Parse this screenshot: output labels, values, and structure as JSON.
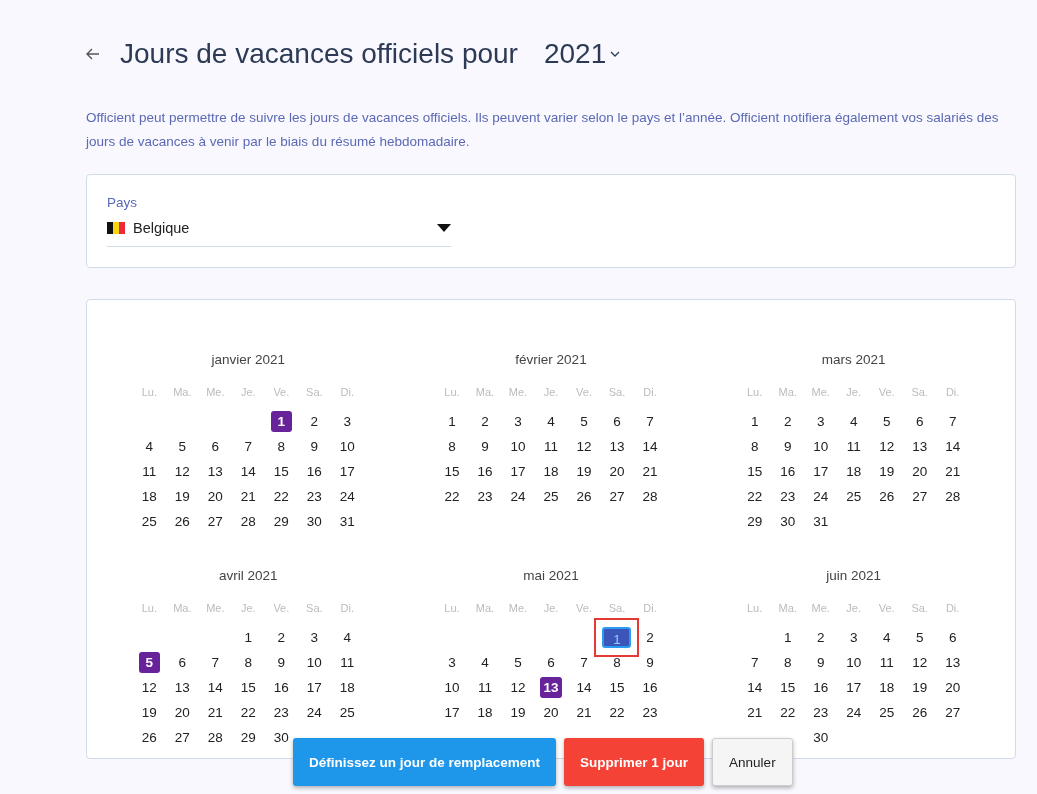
{
  "header": {
    "title": "Jours de vacances officiels pour",
    "year": "2021"
  },
  "description": "Officient peut permettre de suivre les jours de vacances officiels. Ils peuvent varier selon le pays et l’année. Officient notifiera également vos salariés des jours de vacances à venir par le biais du résumé hebdomadaire.",
  "country": {
    "label": "Pays",
    "value": "Belgique"
  },
  "months": [
    {
      "name": "janvier 2021",
      "weekdays": [
        "Lu.",
        "Ma.",
        "Me.",
        "Je.",
        "Ve.",
        "Sa.",
        "Di."
      ],
      "weeks": [
        {
          "kind": "lead",
          "days": [
            {
              "day": "1",
              "kind": "holiday"
            },
            "2",
            "3"
          ]
        },
        {
          "kind": "full",
          "days": [
            "4",
            "5",
            "6",
            "7",
            "8",
            "9",
            "10"
          ]
        },
        {
          "kind": "full",
          "days": [
            "11",
            "12",
            "13",
            "14",
            "15",
            "16",
            "17"
          ]
        },
        {
          "kind": "full",
          "days": [
            "18",
            "19",
            "20",
            "21",
            "22",
            "23",
            "24"
          ]
        },
        {
          "kind": "full",
          "days": [
            "25",
            "26",
            "27",
            "28",
            "29",
            "30",
            "31"
          ]
        }
      ]
    },
    {
      "name": "février 2021",
      "weekdays": [
        "Lu.",
        "Ma.",
        "Me.",
        "Je.",
        "Ve.",
        "Sa.",
        "Di."
      ],
      "weeks": [
        {
          "kind": "full",
          "days": [
            "1",
            "2",
            "3",
            "4",
            "5",
            "6",
            "7"
          ]
        },
        {
          "kind": "full",
          "days": [
            "8",
            "9",
            "10",
            "11",
            "12",
            "13",
            "14"
          ]
        },
        {
          "kind": "full",
          "days": [
            "15",
            "16",
            "17",
            "18",
            "19",
            "20",
            "21"
          ]
        },
        {
          "kind": "full",
          "days": [
            "22",
            "23",
            "24",
            "25",
            "26",
            "27",
            "28"
          ]
        }
      ]
    },
    {
      "name": "mars 2021",
      "weekdays": [
        "Lu.",
        "Ma.",
        "Me.",
        "Je.",
        "Ve.",
        "Sa.",
        "Di."
      ],
      "weeks": [
        {
          "kind": "full",
          "days": [
            "1",
            "2",
            "3",
            "4",
            "5",
            "6",
            "7"
          ]
        },
        {
          "kind": "full",
          "days": [
            "8",
            "9",
            "10",
            "11",
            "12",
            "13",
            "14"
          ]
        },
        {
          "kind": "full",
          "days": [
            "15",
            "16",
            "17",
            "18",
            "19",
            "20",
            "21"
          ]
        },
        {
          "kind": "full",
          "days": [
            "22",
            "23",
            "24",
            "25",
            "26",
            "27",
            "28"
          ]
        },
        {
          "kind": "trail",
          "days": [
            "29",
            "30",
            "31"
          ]
        }
      ]
    },
    {
      "name": "avril 2021",
      "weekdays": [
        "Lu.",
        "Ma.",
        "Me.",
        "Je.",
        "Ve.",
        "Sa.",
        "Di."
      ],
      "weeks": [
        {
          "kind": "lead",
          "days": [
            "1",
            "2",
            "3",
            "4"
          ]
        },
        {
          "kind": "full",
          "days": [
            {
              "day": "5",
              "kind": "holiday"
            },
            "6",
            "7",
            "8",
            "9",
            "10",
            "11"
          ]
        },
        {
          "kind": "full",
          "days": [
            "12",
            "13",
            "14",
            "15",
            "16",
            "17",
            "18"
          ]
        },
        {
          "kind": "full",
          "days": [
            "19",
            "20",
            "21",
            "22",
            "23",
            "24",
            "25"
          ]
        },
        {
          "kind": "trail",
          "days": [
            "26",
            "27",
            "28",
            "29",
            "30"
          ]
        }
      ]
    },
    {
      "name": "mai 2021",
      "weekdays": [
        "Lu.",
        "Ma.",
        "Me.",
        "Je.",
        "Ve.",
        "Sa.",
        "Di."
      ],
      "weeks": [
        {
          "kind": "lead",
          "days": [
            {
              "day": "1",
              "kind": "selected"
            },
            "2"
          ]
        },
        {
          "kind": "full",
          "days": [
            "3",
            "4",
            "5",
            "6",
            "7",
            "8",
            "9"
          ]
        },
        {
          "kind": "full",
          "days": [
            "10",
            "11",
            "12",
            {
              "day": "13",
              "kind": "holiday"
            },
            "14",
            "15",
            "16"
          ]
        },
        {
          "kind": "full",
          "days": [
            "17",
            "18",
            "19",
            "20",
            "21",
            "22",
            "23"
          ]
        }
      ]
    },
    {
      "name": "juin 2021",
      "weekdays": [
        "Lu.",
        "Ma.",
        "Me.",
        "Je.",
        "Ve.",
        "Sa.",
        "Di."
      ],
      "weeks": [
        {
          "kind": "lead",
          "days": [
            "1",
            "2",
            "3",
            "4",
            "5",
            "6"
          ]
        },
        {
          "kind": "full",
          "days": [
            "7",
            "8",
            "9",
            "10",
            "11",
            "12",
            "13"
          ]
        },
        {
          "kind": "full",
          "days": [
            "14",
            "15",
            "16",
            "17",
            "18",
            "19",
            "20"
          ]
        },
        {
          "kind": "full",
          "days": [
            "21",
            "22",
            "23",
            "24",
            "25",
            "26",
            "27"
          ]
        },
        {
          "kind": "covered",
          "days": [
            "30"
          ]
        }
      ]
    }
  ],
  "actions": [
    {
      "label": "Définissez un jour de remplacement",
      "kind": "primary"
    },
    {
      "label": "Supprimer 1 jour",
      "kind": "danger"
    },
    {
      "label": "Annuler",
      "kind": "neutral"
    }
  ]
}
